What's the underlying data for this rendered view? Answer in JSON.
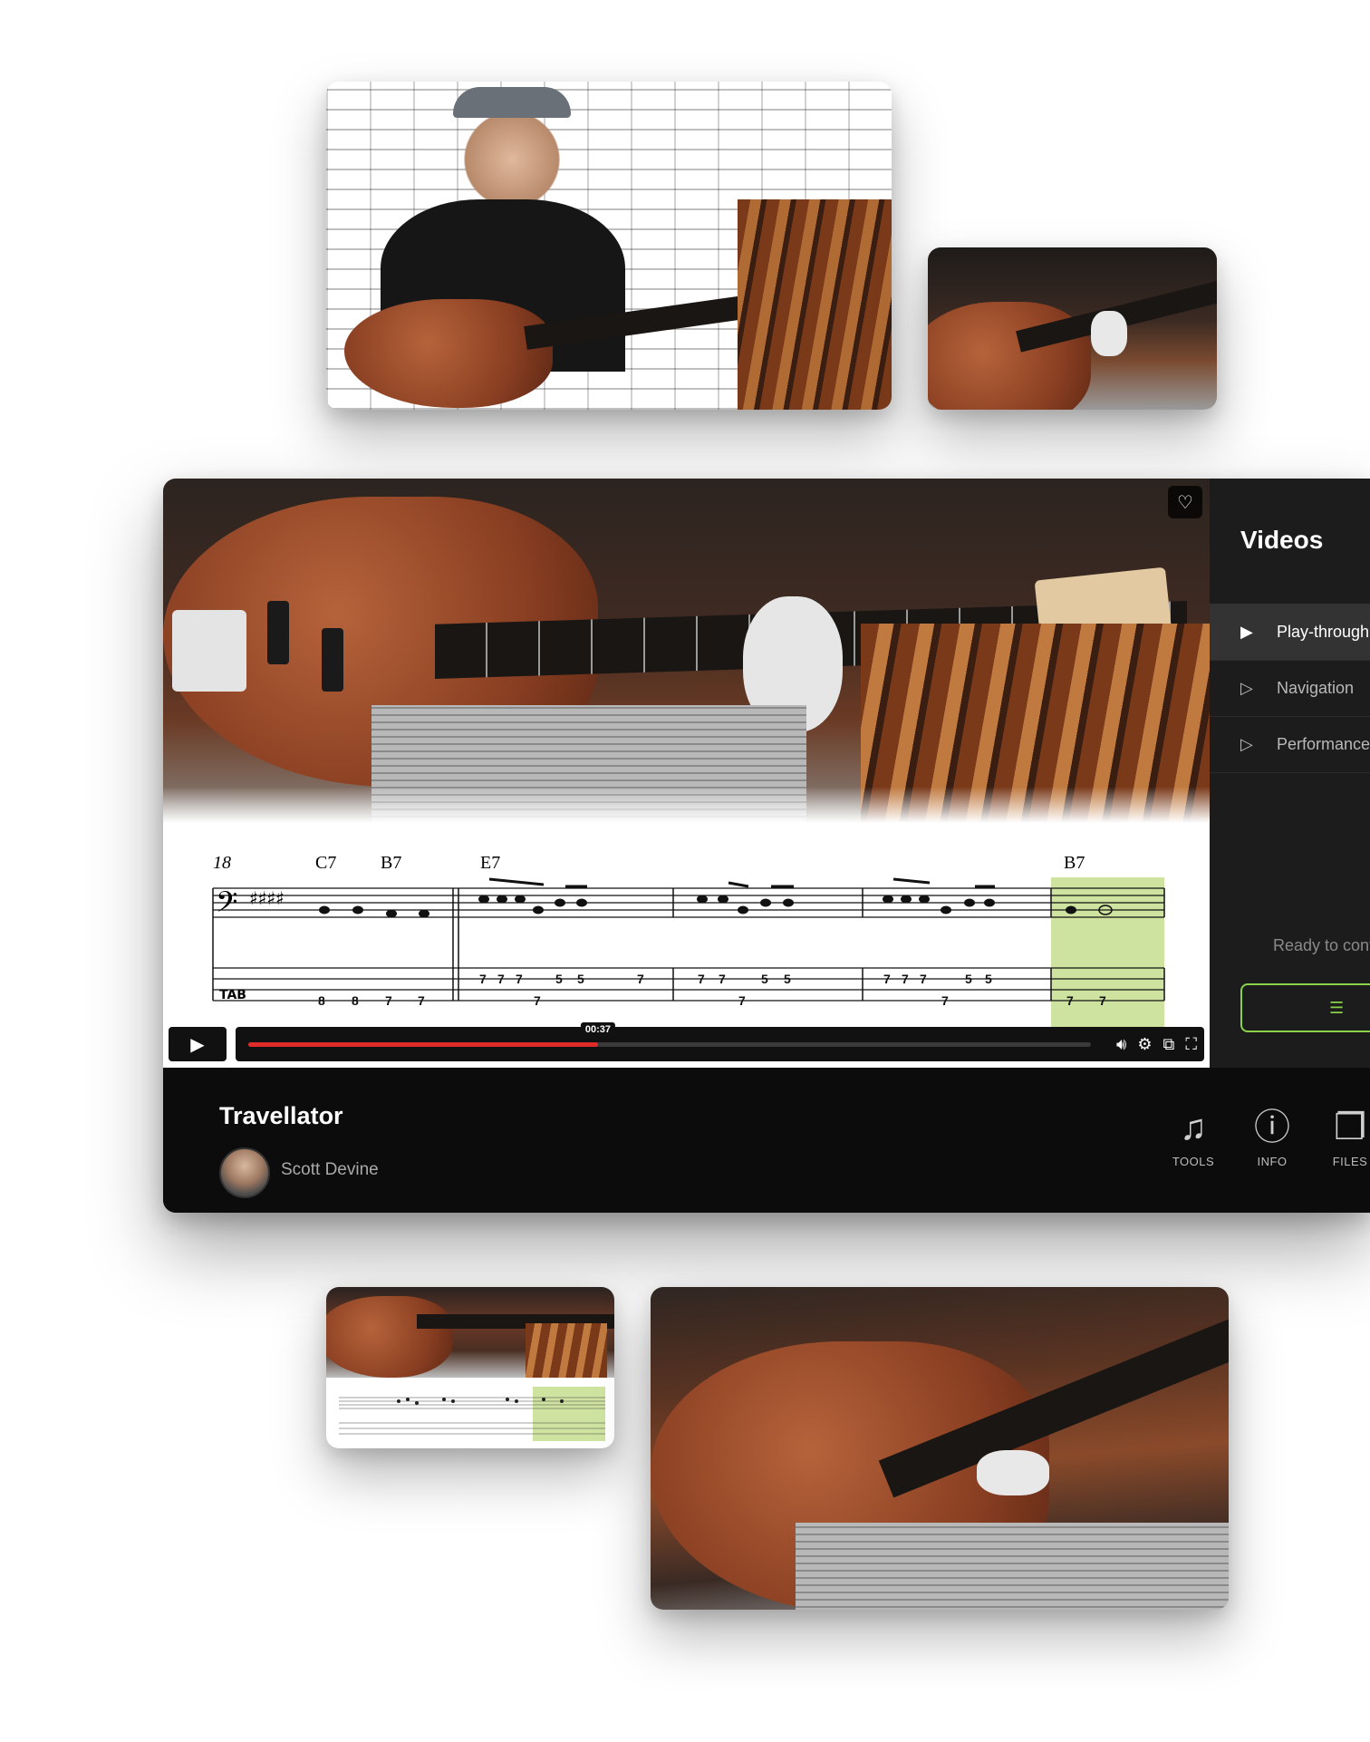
{
  "player": {
    "score": {
      "measure_number": "18",
      "chords": [
        "C7",
        "B7",
        "E7",
        "B7"
      ],
      "tab_numbers": [
        "8",
        "8",
        "7",
        "7",
        "7",
        "7",
        "7",
        "7",
        "5",
        "5",
        "7",
        "7",
        "7",
        "7",
        "5",
        "5",
        "7",
        "7",
        "7",
        "7",
        "5",
        "5",
        "7",
        "7"
      ]
    },
    "controls": {
      "time": "00:37",
      "progress": 0.415
    },
    "sidebar": {
      "title": "Videos",
      "items": [
        {
          "label": "Play-through",
          "active": true
        },
        {
          "label": "Navigation",
          "active": false
        },
        {
          "label": "Performance",
          "active": false
        }
      ],
      "ready_text": "Ready to continue"
    },
    "info": {
      "song_title": "Travellator",
      "author": "Scott Devine",
      "tools": [
        {
          "label": "TOOLS",
          "icon": "music-note-icon"
        },
        {
          "label": "INFO",
          "icon": "info-icon"
        },
        {
          "label": "FILES",
          "icon": "files-icon"
        }
      ]
    }
  },
  "colors": {
    "accent_green": "#8ad24a",
    "progress_red": "#e02b2b",
    "highlight": "#cfe3a0"
  }
}
